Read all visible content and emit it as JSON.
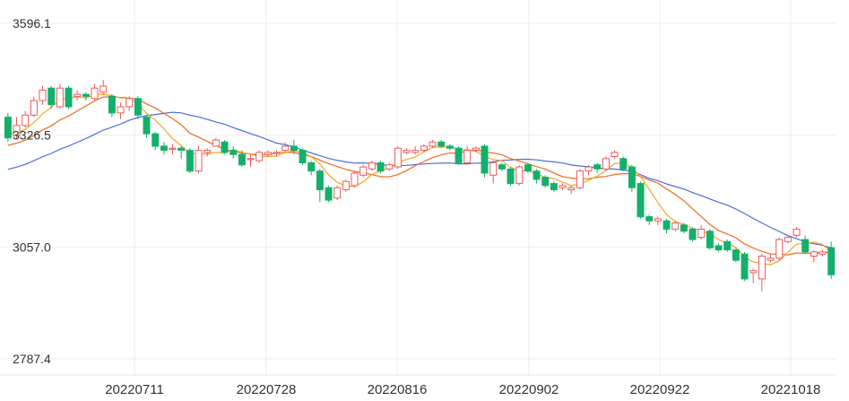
{
  "chart_data": {
    "type": "candlestick",
    "title": "",
    "xlabel": "",
    "ylabel": "",
    "ylim": [
      2787.4,
      3596.1
    ],
    "y_ticks": [
      "3596.1",
      "3326.5",
      "3057.0",
      "2787.4"
    ],
    "x_tick_labels": [
      "20220711",
      "20220728",
      "20220816",
      "20220902",
      "20220922",
      "20221018"
    ],
    "grid": true,
    "colors": {
      "up": "#ec5a5a",
      "down": "#14b06b",
      "ma_short": "#f5a623",
      "ma_mid": "#ee6a1f",
      "ma_long": "#4a6fdc",
      "grid": "#eeeeee"
    },
    "candles": [
      [
        3370,
        3320,
        3380,
        3310
      ],
      [
        3325,
        3350,
        3370,
        3318
      ],
      [
        3350,
        3375,
        3385,
        3345
      ],
      [
        3375,
        3410,
        3420,
        3370
      ],
      [
        3410,
        3435,
        3445,
        3400
      ],
      [
        3440,
        3400,
        3445,
        3390
      ],
      [
        3395,
        3440,
        3450,
        3390
      ],
      [
        3440,
        3395,
        3445,
        3390
      ],
      [
        3420,
        3425,
        3435,
        3410
      ],
      [
        3425,
        3420,
        3430,
        3410
      ],
      [
        3415,
        3440,
        3450,
        3410
      ],
      [
        3430,
        3445,
        3460,
        3425
      ],
      [
        3420,
        3380,
        3425,
        3370
      ],
      [
        3380,
        3395,
        3405,
        3365
      ],
      [
        3395,
        3415,
        3420,
        3385
      ],
      [
        3415,
        3375,
        3420,
        3365
      ],
      [
        3370,
        3330,
        3375,
        3320
      ],
      [
        3330,
        3300,
        3335,
        3290
      ],
      [
        3300,
        3290,
        3310,
        3280
      ],
      [
        3295,
        3295,
        3305,
        3280
      ],
      [
        3295,
        3290,
        3300,
        3270
      ],
      [
        3290,
        3240,
        3295,
        3235
      ],
      [
        3240,
        3290,
        3300,
        3235
      ],
      [
        3285,
        3290,
        3295,
        3275
      ],
      [
        3300,
        3315,
        3320,
        3300
      ],
      [
        3310,
        3285,
        3315,
        3280
      ],
      [
        3290,
        3280,
        3300,
        3270
      ],
      [
        3280,
        3255,
        3290,
        3250
      ],
      [
        3270,
        3270,
        3280,
        3250
      ],
      [
        3265,
        3285,
        3290,
        3260
      ],
      [
        3280,
        3285,
        3290,
        3275
      ],
      [
        3285,
        3285,
        3290,
        3275
      ],
      [
        3290,
        3300,
        3310,
        3285
      ],
      [
        3300,
        3290,
        3315,
        3280
      ],
      [
        3290,
        3260,
        3295,
        3255
      ],
      [
        3260,
        3240,
        3265,
        3230
      ],
      [
        3240,
        3195,
        3245,
        3165
      ],
      [
        3200,
        3170,
        3205,
        3165
      ],
      [
        3175,
        3200,
        3205,
        3170
      ],
      [
        3195,
        3215,
        3220,
        3190
      ],
      [
        3205,
        3235,
        3240,
        3200
      ],
      [
        3230,
        3250,
        3255,
        3225
      ],
      [
        3245,
        3260,
        3265,
        3240
      ],
      [
        3260,
        3240,
        3265,
        3235
      ],
      [
        3245,
        3255,
        3260,
        3240
      ],
      [
        3250,
        3295,
        3300,
        3245
      ],
      [
        3285,
        3290,
        3295,
        3280
      ],
      [
        3285,
        3290,
        3300,
        3280
      ],
      [
        3290,
        3300,
        3305,
        3285
      ],
      [
        3300,
        3310,
        3315,
        3295
      ],
      [
        3310,
        3300,
        3315,
        3295
      ],
      [
        3300,
        3295,
        3305,
        3290
      ],
      [
        3295,
        3260,
        3300,
        3255
      ],
      [
        3260,
        3290,
        3300,
        3255
      ],
      [
        3290,
        3295,
        3300,
        3285
      ],
      [
        3300,
        3235,
        3305,
        3225
      ],
      [
        3230,
        3260,
        3265,
        3210
      ],
      [
        3255,
        3245,
        3260,
        3240
      ],
      [
        3245,
        3210,
        3250,
        3205
      ],
      [
        3210,
        3250,
        3255,
        3205
      ],
      [
        3255,
        3240,
        3260,
        3235
      ],
      [
        3240,
        3220,
        3245,
        3210
      ],
      [
        3225,
        3205,
        3230,
        3200
      ],
      [
        3210,
        3195,
        3215,
        3190
      ],
      [
        3200,
        3205,
        3210,
        3195
      ],
      [
        3195,
        3200,
        3205,
        3185
      ],
      [
        3200,
        3240,
        3245,
        3195
      ],
      [
        3240,
        3250,
        3255,
        3230
      ],
      [
        3255,
        3245,
        3260,
        3235
      ],
      [
        3245,
        3270,
        3275,
        3240
      ],
      [
        3275,
        3285,
        3290,
        3270
      ],
      [
        3270,
        3245,
        3275,
        3240
      ],
      [
        3250,
        3200,
        3255,
        3190
      ],
      [
        3210,
        3130,
        3215,
        3125
      ],
      [
        3130,
        3120,
        3135,
        3110
      ],
      [
        3120,
        3125,
        3130,
        3110
      ],
      [
        3120,
        3100,
        3125,
        3090
      ],
      [
        3100,
        3115,
        3120,
        3095
      ],
      [
        3110,
        3095,
        3115,
        3090
      ],
      [
        3100,
        3075,
        3105,
        3070
      ],
      [
        3080,
        3100,
        3110,
        3075
      ],
      [
        3095,
        3055,
        3100,
        3050
      ],
      [
        3060,
        3050,
        3065,
        3045
      ],
      [
        3070,
        3050,
        3075,
        3045
      ],
      [
        3050,
        3025,
        3055,
        3020
      ],
      [
        3040,
        2980,
        3045,
        2975
      ],
      [
        2995,
        3000,
        3005,
        2970
      ],
      [
        2980,
        3035,
        3040,
        2950
      ],
      [
        3025,
        3030,
        3040,
        3020
      ],
      [
        3030,
        3075,
        3080,
        3025
      ],
      [
        3070,
        3080,
        3085,
        3065
      ],
      [
        3085,
        3100,
        3105,
        3080
      ],
      [
        3075,
        3045,
        3085,
        3040
      ],
      [
        3035,
        3045,
        3050,
        3020
      ],
      [
        3040,
        3045,
        3050,
        3035
      ],
      [
        3055,
        2990,
        3070,
        2980
      ]
    ]
  }
}
